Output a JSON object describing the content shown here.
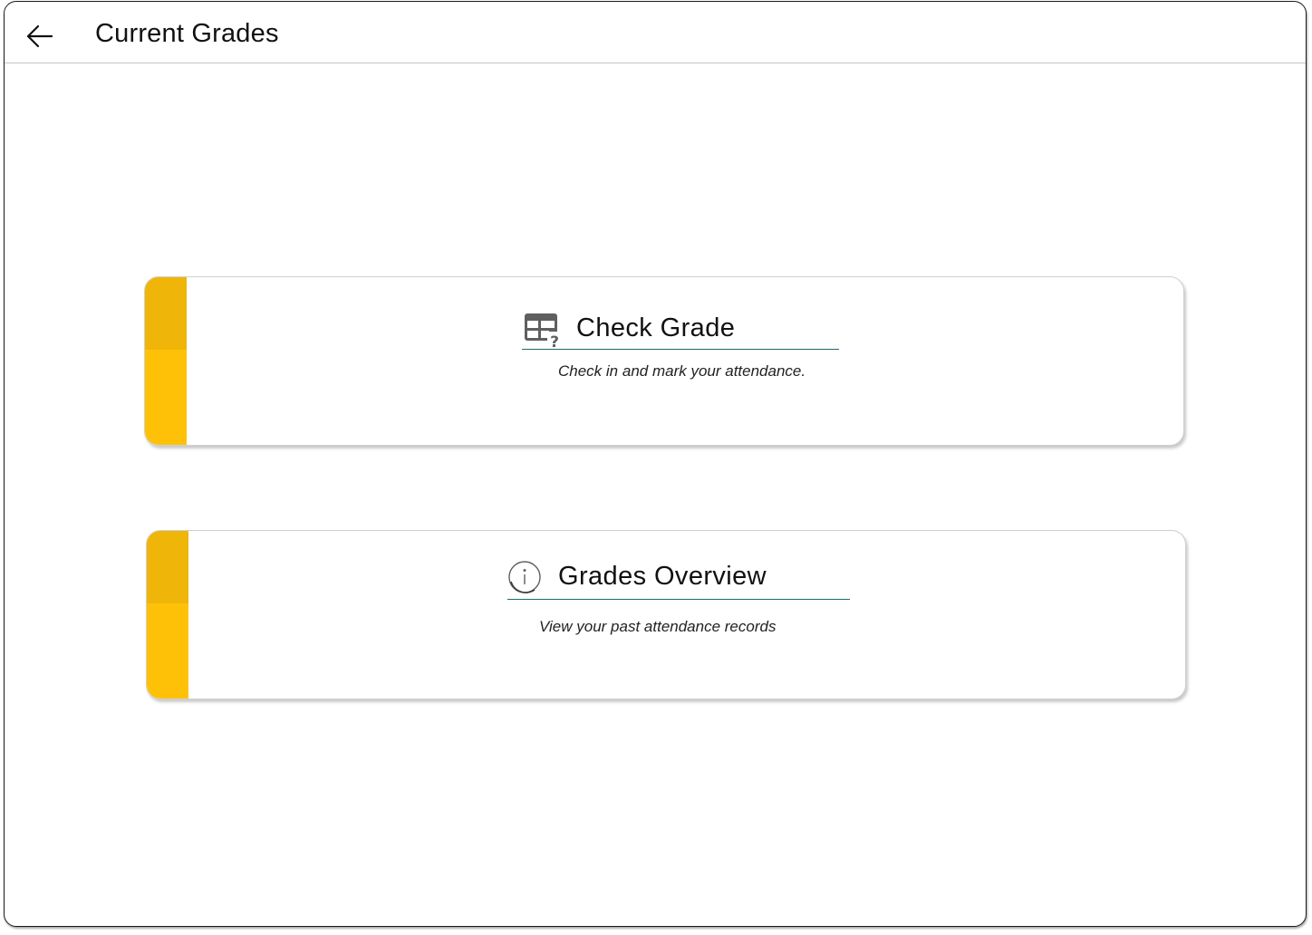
{
  "header": {
    "title": "Current Grades",
    "back_icon": "arrow-left-icon"
  },
  "cards": [
    {
      "title": "Check Grade",
      "subtitle": "Check in and mark your attendance.",
      "icon": "table-question-icon",
      "accent_color": "#ffc107"
    },
    {
      "title": "Grades Overview",
      "subtitle": "View your past attendance records",
      "icon": "info-circle-icon",
      "accent_color": "#ffc107"
    }
  ],
  "colors": {
    "accent": "#ffc107",
    "accent_dark": "#efb509",
    "underline": "#1b6b6b",
    "text": "#111111"
  }
}
